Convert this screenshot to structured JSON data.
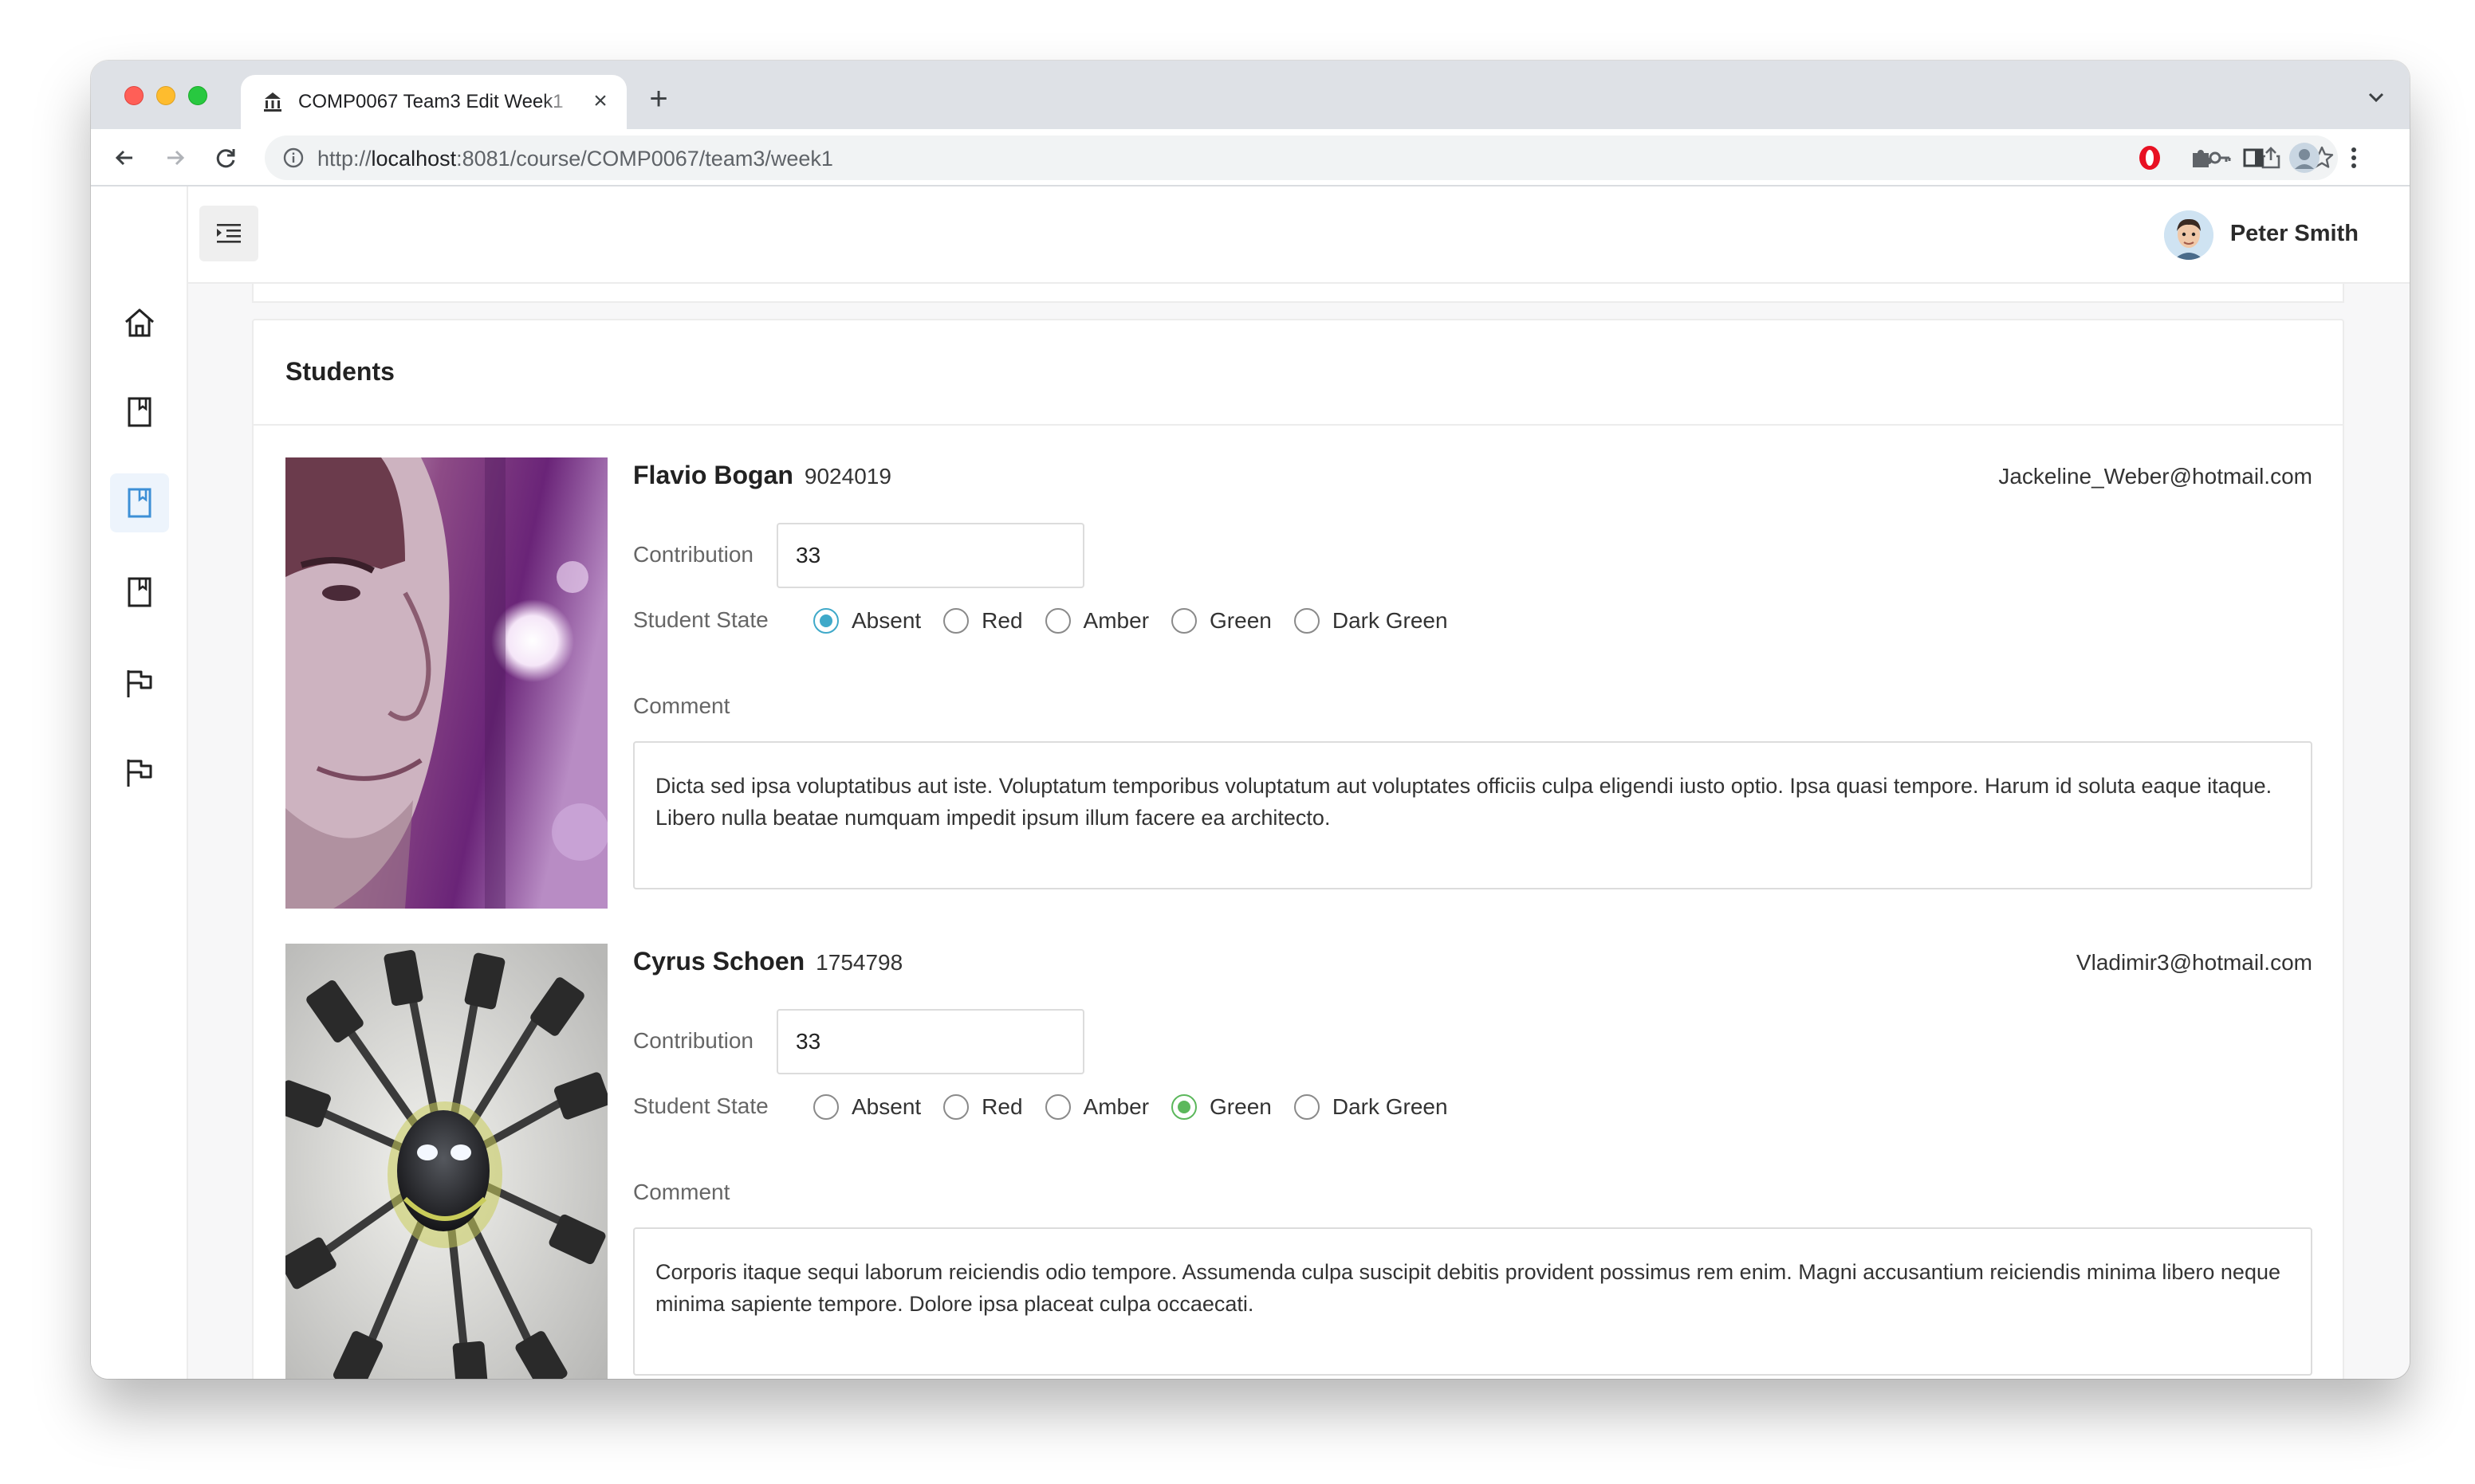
{
  "browser": {
    "tab_title": "COMP0067 Team3 Edit Week1",
    "url_prefix": "http://",
    "url_host": "localhost",
    "url_path": ":8081/course/COMP0067/team3/week1"
  },
  "user": {
    "name": "Peter Smith"
  },
  "card": {
    "title": "Students"
  },
  "labels": {
    "contribution": "Contribution",
    "student_state": "Student State",
    "comment": "Comment"
  },
  "state_options": [
    "Absent",
    "Red",
    "Amber",
    "Green",
    "Dark Green"
  ],
  "students": [
    {
      "name": "Flavio Bogan",
      "id": "9024019",
      "email": "Jackeline_Weber@hotmail.com",
      "contribution": "33",
      "state": "Absent",
      "state_color": "#3fa9c9",
      "comment": "Dicta sed ipsa voluptatibus aut iste. Voluptatum temporibus voluptatum aut voluptates officiis culpa eligendi iusto optio. Ipsa quasi tempore. Harum id soluta eaque itaque. Libero nulla beatae numquam impedit ipsum illum facere ea architecto."
    },
    {
      "name": "Cyrus Schoen",
      "id": "1754798",
      "email": "Vladimir3@hotmail.com",
      "contribution": "33",
      "state": "Green",
      "state_color": "#5cb85c",
      "comment": "Corporis itaque sequi laborum reiciendis odio tempore. Assumenda culpa suscipit debitis provident possimus rem enim. Magni accusantium reiciendis minima libero neque minima sapiente tempore. Dolore ipsa placeat culpa occaecati."
    }
  ],
  "icons": {
    "nav": [
      "home-icon",
      "book-icon",
      "book-icon",
      "book-icon",
      "flag-icon",
      "flag-icon"
    ],
    "active_nav_color": "#3d8fd6"
  }
}
